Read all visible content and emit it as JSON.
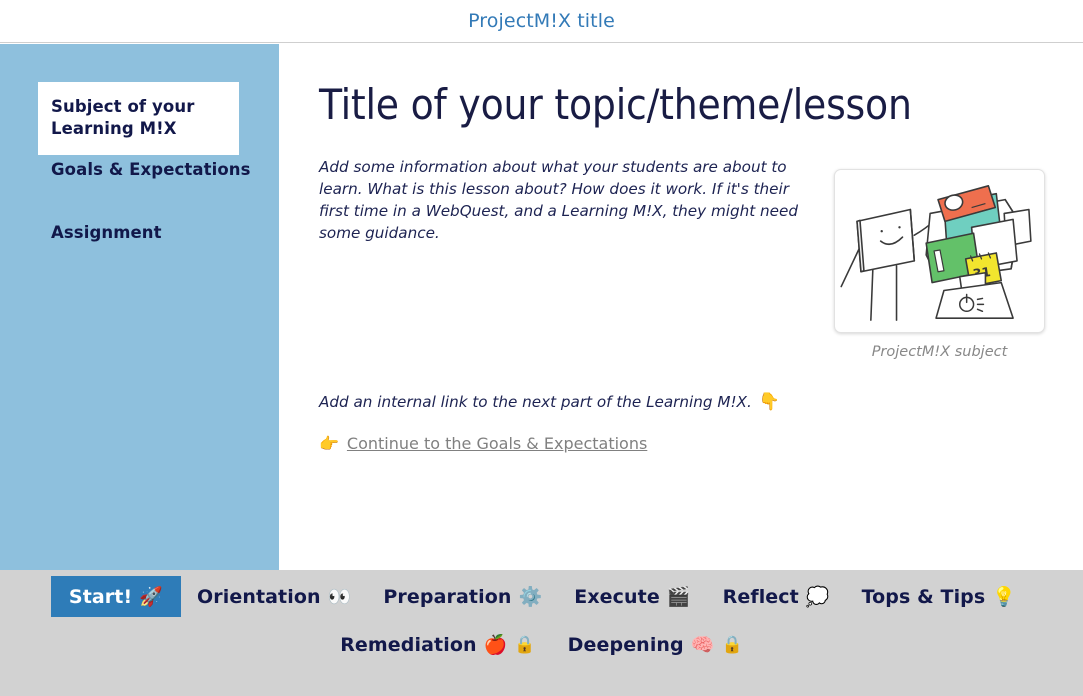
{
  "header": {
    "title": "ProjectM!X title",
    "title_color": "#337ab7"
  },
  "sidebar": {
    "background_color": "#8ec0dd",
    "text_color": "#12184a",
    "items": [
      {
        "label": "Subject of your Learning M!X",
        "active": true
      },
      {
        "label": "Goals & Expectations",
        "active": false
      },
      {
        "label": "Assignment",
        "active": false
      }
    ]
  },
  "main": {
    "title": "Title of your topic/theme/lesson",
    "intro_paragraph": "Add some information about what your students are about to learn. What is this lesson about? How does it work. If it's their first time in a WebQuest, and a Learning M!X, they might need some guidance.",
    "figure": {
      "caption": "ProjectM!X subject",
      "alt_name": "projector-devices-illustration",
      "colors": {
        "projector": "#ef6f4e",
        "screen_teal": "#6fcfc0",
        "tablet_green": "#63c169",
        "calendar_yellow": "#f2e52e",
        "outline": "#3a3a3a"
      },
      "calendar_number": "31"
    },
    "link_note": {
      "text": "Add an internal link to the next part of the Learning M!X.",
      "emoji": "👇",
      "emoji_name": "pointing-down-icon"
    },
    "continue_link": {
      "emoji": "👉",
      "emoji_name": "pointing-right-icon",
      "label": "Continue to the Goals & Expectations",
      "color": "#808080"
    }
  },
  "bottom_nav": {
    "background_color": "#d2d2d2",
    "active_background": "#2e7cb8",
    "text_color": "#12184a",
    "row1": [
      {
        "label": "Start!",
        "emoji": "🚀",
        "emoji_name": "rocket-icon",
        "active": true,
        "locked": false
      },
      {
        "label": "Orientation",
        "emoji": "👀",
        "emoji_name": "eyes-icon",
        "active": false,
        "locked": false
      },
      {
        "label": "Preparation",
        "emoji": "⚙️",
        "emoji_name": "gear-icon",
        "active": false,
        "locked": false
      },
      {
        "label": "Execute",
        "emoji": "🎬",
        "emoji_name": "clapper-board-icon",
        "active": false,
        "locked": false
      },
      {
        "label": "Reflect",
        "emoji": "💭",
        "emoji_name": "thought-balloon-icon",
        "active": false,
        "locked": false
      },
      {
        "label": "Tops & Tips",
        "emoji": "💡",
        "emoji_name": "light-bulb-icon",
        "active": false,
        "locked": false
      }
    ],
    "row2": [
      {
        "label": "Remediation",
        "emoji": "🍎",
        "emoji_name": "red-apple-icon",
        "active": false,
        "locked": true,
        "lock": "🔒"
      },
      {
        "label": "Deepening",
        "emoji": "🧠",
        "emoji_name": "brain-icon",
        "active": false,
        "locked": true,
        "lock": "🔒"
      }
    ]
  }
}
